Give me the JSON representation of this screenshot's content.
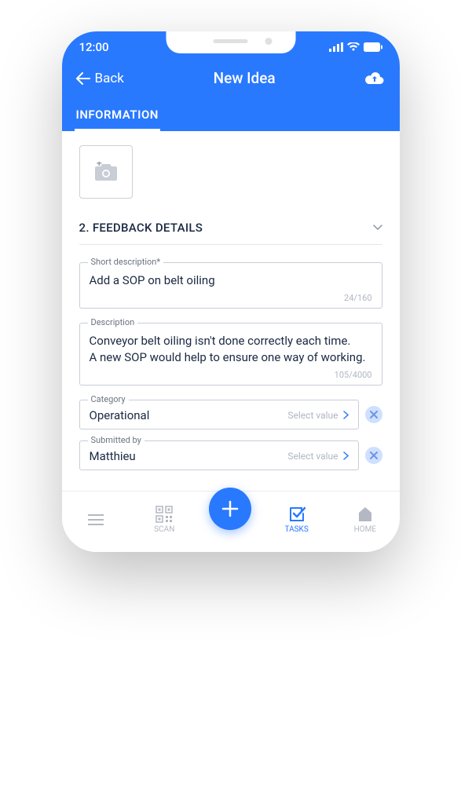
{
  "status": {
    "time": "12:00"
  },
  "header": {
    "back_label": "Back",
    "title": "New Idea",
    "tab_label": "INFORMATION"
  },
  "section": {
    "title": "2. FEEDBACK DETAILS"
  },
  "fields": {
    "short_desc": {
      "label": "Short description*",
      "value": "Add a SOP on belt oiling",
      "counter": "24/160"
    },
    "description": {
      "label": "Description",
      "value": "Conveyor belt oiling isn't done correctly each time.\nA new SOP would help to ensure one way of working.",
      "counter": "105/4000"
    },
    "category": {
      "label": "Category",
      "value": "Operational",
      "hint": "Select value"
    },
    "submitted_by": {
      "label": "Submitted by",
      "value": "Matthieu",
      "hint": "Select value"
    }
  },
  "nav": {
    "scan": "SCAN",
    "tasks": "TASKS",
    "home": "HOME"
  }
}
